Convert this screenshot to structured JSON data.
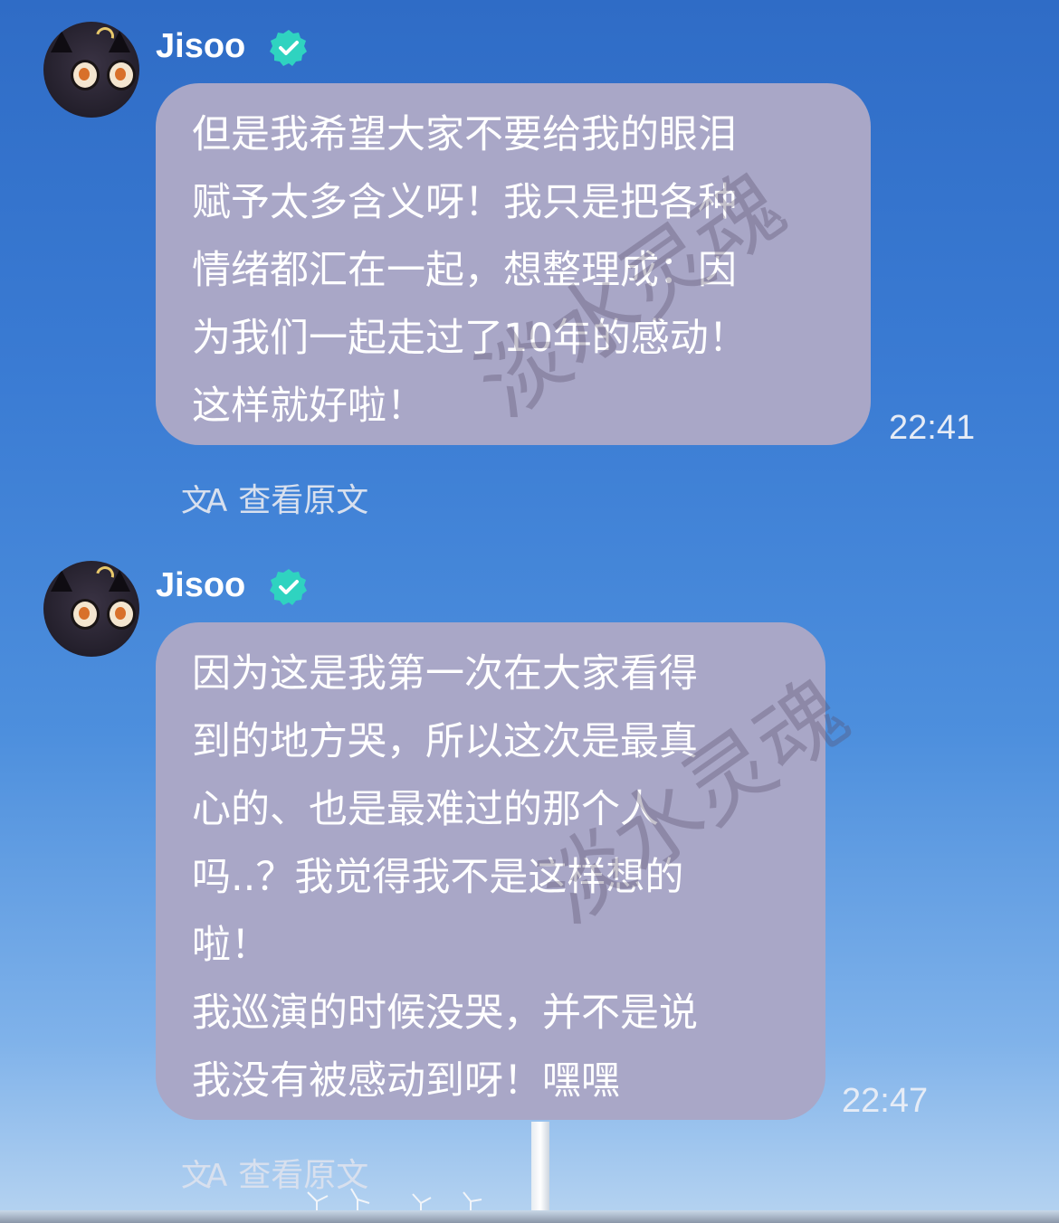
{
  "messages": [
    {
      "sender": "Jisoo",
      "lines": [
        "但是我希望大家不要给我的眼泪",
        "赋予太多含义呀！我只是把各种",
        "情绪都汇在一起，想整理成：因",
        "为我们一起走过了10年的感动！",
        "这样就好啦！"
      ],
      "time": "22:41",
      "translate_label": "查看原文"
    },
    {
      "sender": "Jisoo",
      "lines": [
        "因为这是我第一次在大家看得",
        "到的地方哭，所以这次是最真",
        "心的、也是最难过的那个人",
        "吗..？我觉得我不是这样想的",
        "啦！",
        "我巡演的时候没哭，并不是说",
        "我没有被感动到呀！嘿嘿"
      ],
      "time": "22:47",
      "translate_label": "查看原文"
    }
  ],
  "watermark": "淡水灵魂",
  "icons": {
    "verified": "verified-badge-icon",
    "translate": "translate-icon"
  },
  "colors": {
    "bubble": "#a9a7c7",
    "verified": "#2fd3c0",
    "sky_top": "#2f6cc6"
  }
}
